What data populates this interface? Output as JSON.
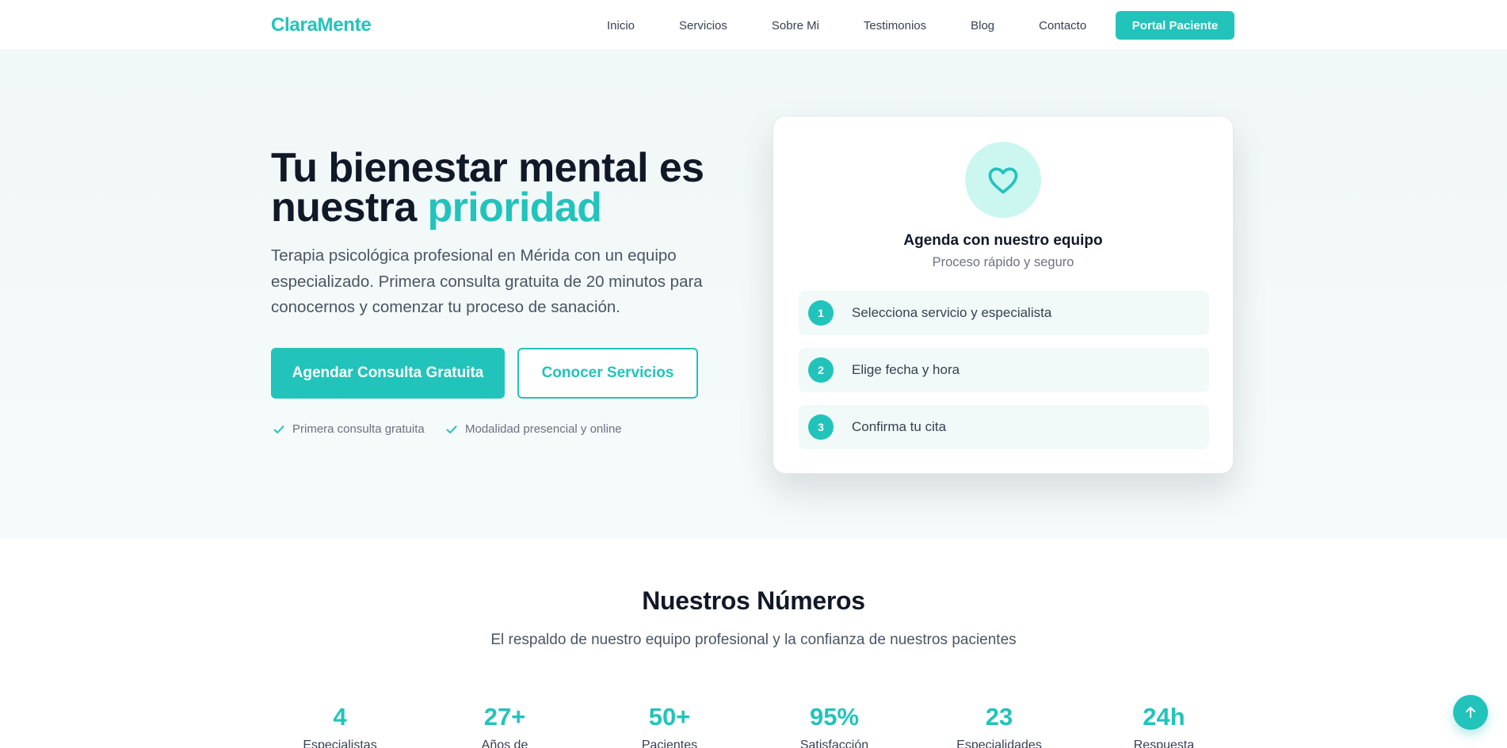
{
  "brand": {
    "name": "ClaraMente",
    "accent_color": "#22c3bb"
  },
  "nav": {
    "links": [
      "Inicio",
      "Servicios",
      "Sobre Mi",
      "Testimonios",
      "Blog",
      "Contacto"
    ],
    "portal_button": "Portal Paciente"
  },
  "hero": {
    "title_main": "Tu bienestar mental es nuestra ",
    "title_accent": "prioridad",
    "subtitle": "Terapia psicológica profesional en Mérida con un equipo especializado. Primera consulta gratuita de 20 minutos para conocernos y comenzar tu proceso de sanación.",
    "primary_button": "Agendar Consulta Gratuita",
    "secondary_button": "Conocer Servicios",
    "features": [
      "Primera consulta gratuita",
      "Modalidad presencial y online"
    ]
  },
  "booking_card": {
    "icon": "heart-icon",
    "title": "Agenda con nuestro equipo",
    "subtitle": "Proceso rápido y seguro",
    "steps": [
      {
        "number": "1",
        "label": "Selecciona servicio y especialista"
      },
      {
        "number": "2",
        "label": "Elige fecha y hora"
      },
      {
        "number": "3",
        "label": "Confirma tu cita"
      }
    ]
  },
  "stats_section": {
    "title": "Nuestros Números",
    "subtitle": "El respaldo de nuestro equipo profesional y la confianza de nuestros pacientes",
    "stats": [
      {
        "value": "4",
        "label": "Especialistas"
      },
      {
        "value": "27+",
        "label": "Años de"
      },
      {
        "value": "50+",
        "label": "Pacientes"
      },
      {
        "value": "95%",
        "label": "Satisfacción"
      },
      {
        "value": "23",
        "label": "Especialidades"
      },
      {
        "value": "24h",
        "label": "Respuesta"
      }
    ]
  },
  "scroll_top": {
    "icon": "arrow-up-icon"
  }
}
